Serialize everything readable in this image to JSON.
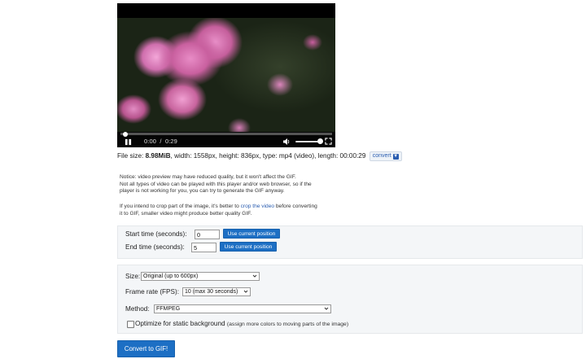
{
  "player": {
    "current_time": "0:00",
    "separator": "/",
    "duration": "0:29",
    "progress_fraction": 0.0,
    "volume_fraction": 0.9
  },
  "fileinfo": {
    "size_label": "File size: ",
    "size_value": "8.98MiB",
    "details": ", width: 1558px, height: 836px, type: mp4 (video), length: 00:00:29",
    "convert_label": "convert"
  },
  "notice": {
    "line1": "Notice: video preview may have reduced quality, but it won't affect the GIF.",
    "line2": "Not all types of video can be played with this player and/or web browser, so if the",
    "line3": "player is not working for you, you can try to generate the GIF anyway.",
    "crop_line1_start": "If you intend to crop part of the image, it's better to ",
    "crop_link": "crop the video",
    "crop_line1_end": " before converting",
    "crop_line2": "it to GIF, smaller video might produce better quality GIF."
  },
  "trim": {
    "start_label": "Start time (seconds):",
    "start_value": "0",
    "end_label": "End time (seconds):",
    "end_value": "5",
    "use_current_label": "Use current position"
  },
  "options": {
    "size_label": "Size:",
    "size_value": "Original (up to 600px)",
    "fps_label": "Frame rate (FPS):",
    "fps_value": "10 (max 30 seconds)",
    "method_label": "Method:",
    "method_value": "FFMPEG",
    "optimize_label": "Optimize for static background",
    "optimize_note": "(assign more colors to moving parts of the image)",
    "optimize_checked": false
  },
  "submit": {
    "label": "Convert to GIF!"
  },
  "colors": {
    "accent": "#1d6fc4",
    "link": "#2a5db0",
    "panel_bg": "#f4f6f8"
  }
}
